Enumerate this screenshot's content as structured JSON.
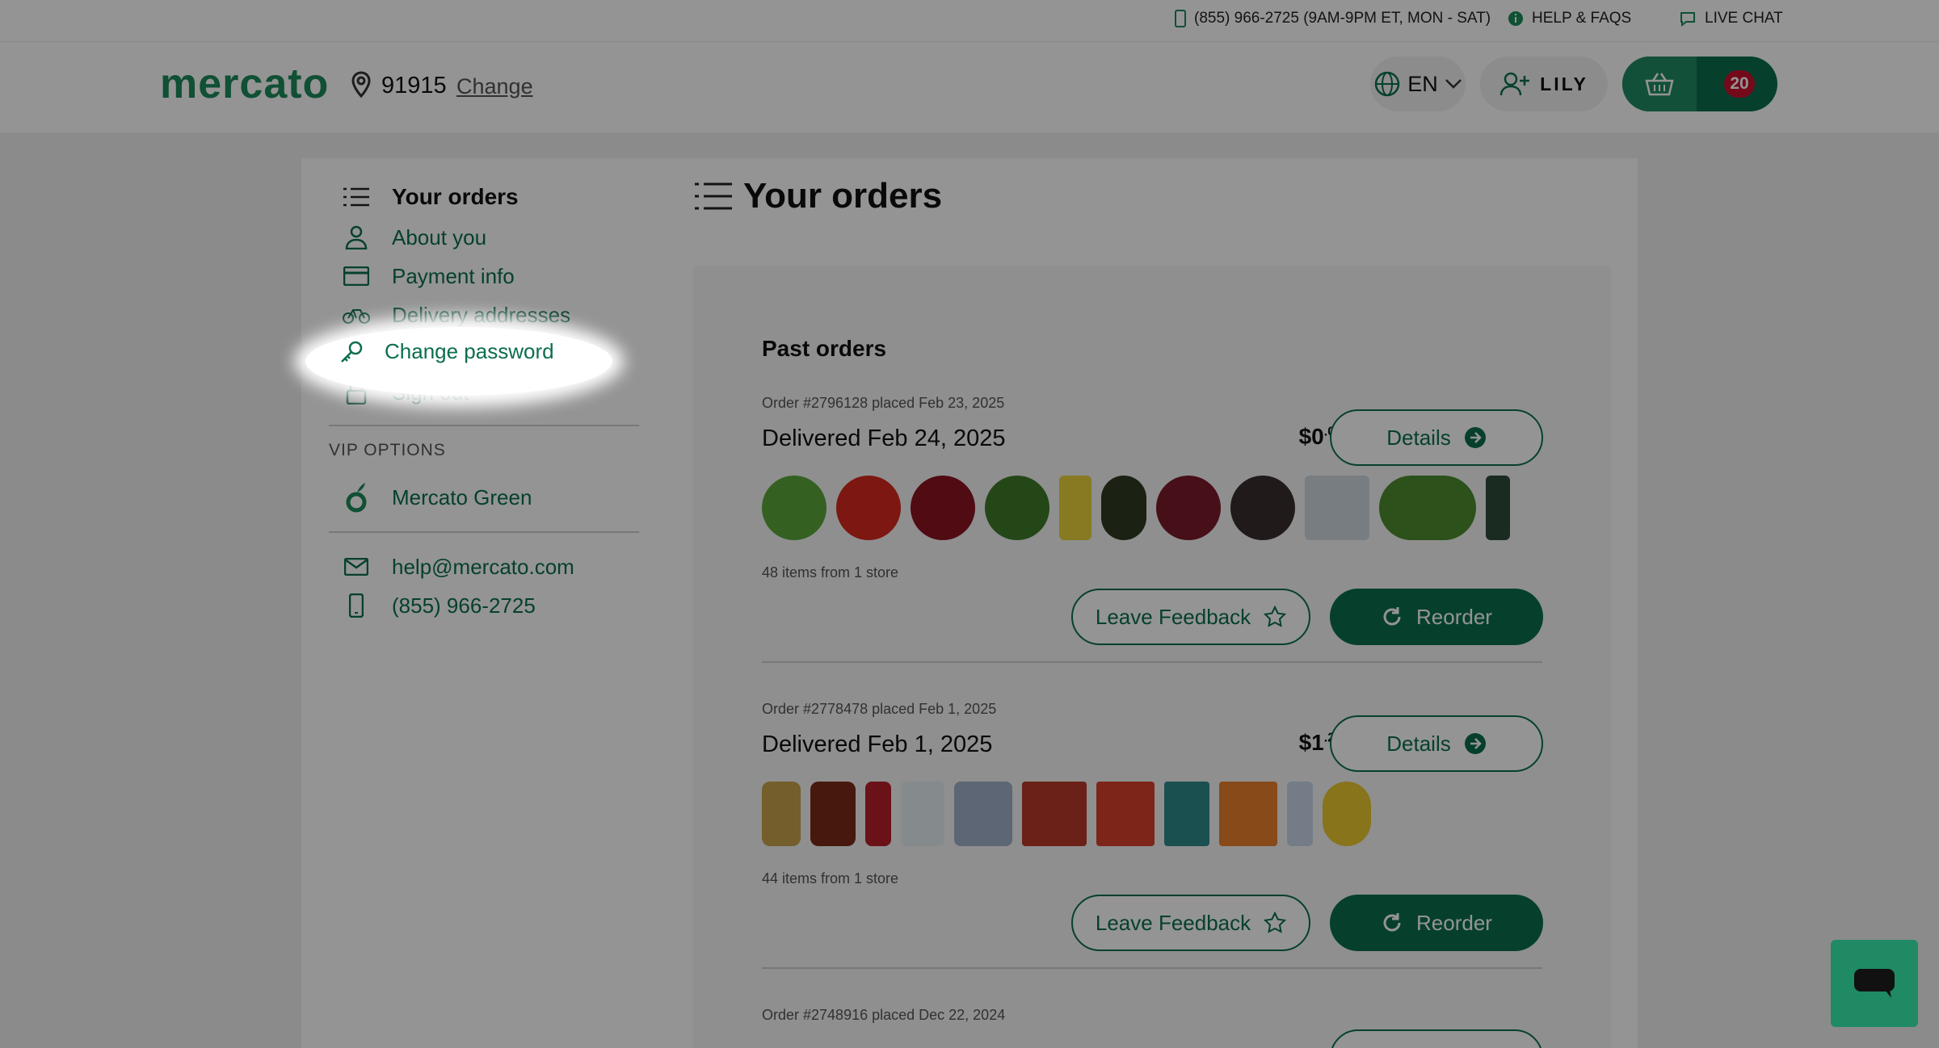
{
  "topbar": {
    "phone": "(855) 966-2725 (9AM-9PM ET, MON - SAT)",
    "help": "HELP & FAQS",
    "chat": "LIVE CHAT"
  },
  "header": {
    "logo": "mercato",
    "zip": "91915",
    "change": "Change",
    "language": "EN",
    "user": "LILY",
    "cart_count": "20"
  },
  "sidebar": {
    "items": [
      {
        "label": "Your orders",
        "icon": "list-icon"
      },
      {
        "label": "About you",
        "icon": "person-icon"
      },
      {
        "label": "Payment info",
        "icon": "credit-card-icon"
      },
      {
        "label": "Delivery addresses",
        "icon": "bike-icon"
      },
      {
        "label": "Change password",
        "icon": "key-icon"
      },
      {
        "label": "Sign out",
        "icon": "lock-icon"
      }
    ],
    "vip_title": "VIP OPTIONS",
    "vip_item": "Mercato Green",
    "email": "help@mercato.com",
    "phone": "(855) 966-2725"
  },
  "main": {
    "title": "Your orders",
    "past_title": "Past orders",
    "orders": [
      {
        "meta": "Order #2796128 placed Feb 23, 2025",
        "status": "Delivered Feb 24, 2025",
        "price_whole": "$0",
        "price_cents": ".00",
        "count": "48 items from 1 store",
        "details": "Details",
        "feedback": "Leave Feedback",
        "reorder": "Reorder"
      },
      {
        "meta": "Order #2778478 placed Feb 1, 2025",
        "status": "Delivered Feb 1, 2025",
        "price_whole": "$1",
        "price_cents": ".29",
        "count": "44 items from 1 store",
        "details": "Details",
        "feedback": "Leave Feedback",
        "reorder": "Reorder"
      },
      {
        "meta": "Order #2748916 placed Dec 22, 2024"
      }
    ]
  },
  "colors": {
    "brand": "#0b6e4f",
    "brand_light": "#1f8a63",
    "badge": "#c8102e"
  }
}
